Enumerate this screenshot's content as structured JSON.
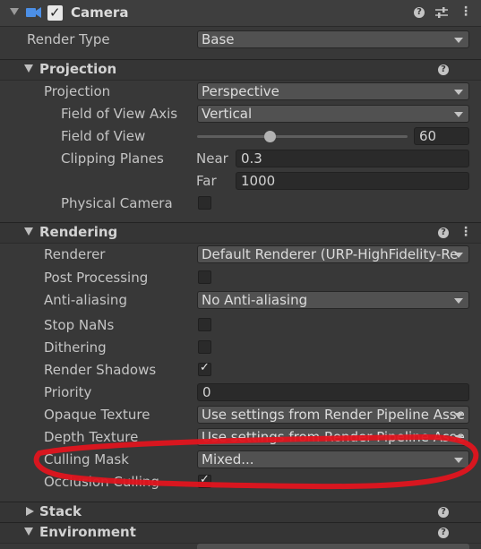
{
  "header": {
    "title": "Camera",
    "enabled": true
  },
  "render_type": {
    "label": "Render Type",
    "value": "Base"
  },
  "projection_section": {
    "title": "Projection",
    "projection": {
      "label": "Projection",
      "value": "Perspective"
    },
    "fov_axis": {
      "label": "Field of View Axis",
      "value": "Vertical"
    },
    "fov": {
      "label": "Field of View",
      "value": "60",
      "slider_level": 0.35
    },
    "clipping": {
      "label": "Clipping Planes",
      "near_label": "Near",
      "near_value": "0.3",
      "far_label": "Far",
      "far_value": "1000"
    },
    "physical_camera": {
      "label": "Physical Camera",
      "checked": false
    }
  },
  "rendering_section": {
    "title": "Rendering",
    "renderer": {
      "label": "Renderer",
      "value": "Default Renderer (URP-HighFidelity-Re"
    },
    "post_processing": {
      "label": "Post Processing",
      "checked": false
    },
    "anti_aliasing": {
      "label": "Anti-aliasing",
      "value": "No Anti-aliasing"
    },
    "stop_nans": {
      "label": "Stop NaNs",
      "checked": false
    },
    "dithering": {
      "label": "Dithering",
      "checked": false
    },
    "render_shadows": {
      "label": "Render Shadows",
      "checked": true
    },
    "priority": {
      "label": "Priority",
      "value": "0"
    },
    "opaque_texture": {
      "label": "Opaque Texture",
      "value": "Use settings from Render Pipeline Asse"
    },
    "depth_texture": {
      "label": "Depth Texture",
      "value": "Use settings from Render Pipeline Asse"
    },
    "culling_mask": {
      "label": "Culling Mask",
      "value": "Mixed..."
    },
    "occlusion_culling": {
      "label": "Occlusion Culling",
      "checked": true
    }
  },
  "stack_section": {
    "title": "Stack"
  },
  "environment_section": {
    "title": "Environment"
  },
  "colors": {
    "annotation": "#e0141e",
    "background": "#383838"
  }
}
